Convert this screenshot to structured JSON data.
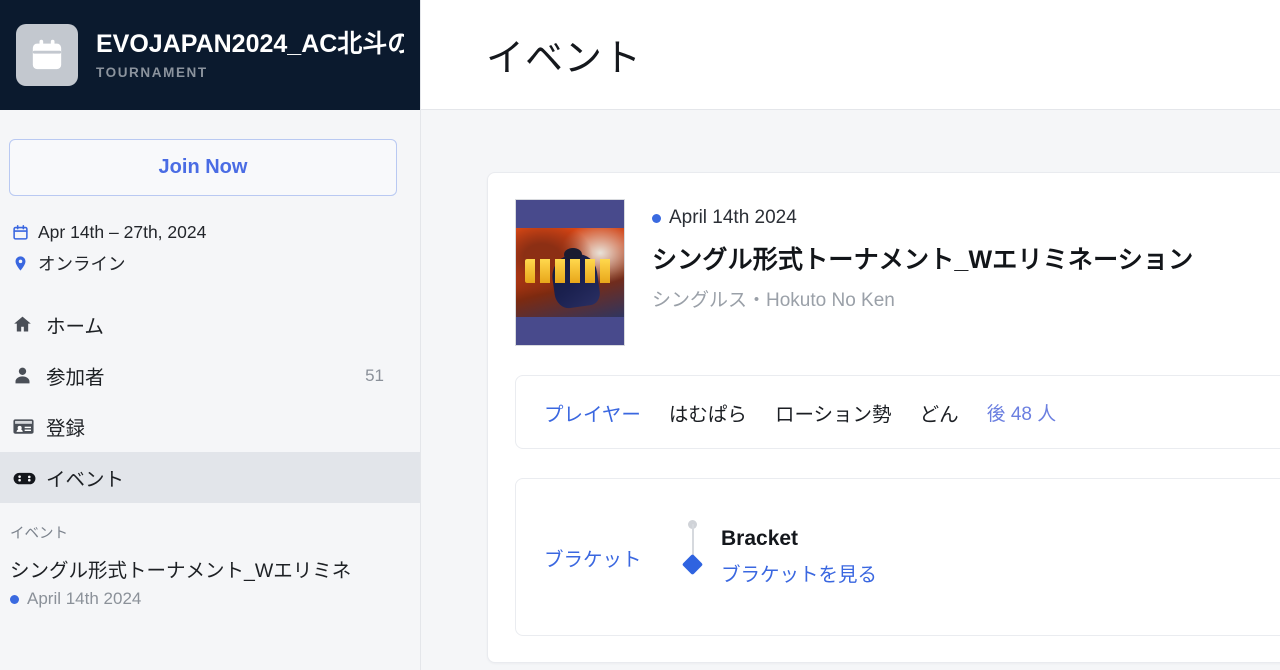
{
  "sidebar": {
    "tournament": {
      "title": "EVOJAPAN2024_AC北斗の",
      "subtitle": "TOURNAMENT",
      "logo_icon": "calendar-icon"
    },
    "join_button": "Join Now",
    "info": [
      {
        "icon": "calendar-icon",
        "text": "Apr 14th – 27th, 2024"
      },
      {
        "icon": "location-pin-icon",
        "text": "オンライン"
      }
    ],
    "nav": [
      {
        "icon": "home-icon",
        "label": "ホーム",
        "count": "",
        "active": false
      },
      {
        "icon": "person-icon",
        "label": "参加者",
        "count": "51",
        "active": false
      },
      {
        "icon": "id-card-icon",
        "label": "登録",
        "count": "",
        "active": false
      },
      {
        "icon": "gamepad-icon",
        "label": "イベント",
        "count": "",
        "active": true
      }
    ],
    "section": {
      "title": "イベント",
      "event_name": "シングル形式トーナメント_Wエリミネ",
      "event_date": "April 14th 2024"
    }
  },
  "header": {
    "page_title": "イベント"
  },
  "event": {
    "date": "April 14th 2024",
    "name": "シングル形式トーナメント_Wエリミネーション",
    "subtitle": "シングルス・Hokuto No Ken",
    "thumbnail_alt": "北斗の拳"
  },
  "players_panel": {
    "label": "プレイヤー",
    "names": [
      "はむぱら",
      "ローション勢",
      "どん"
    ],
    "more": "後 48 人"
  },
  "bracket_panel": {
    "label": "ブラケット",
    "title": "Bracket",
    "link": "ブラケットを見る"
  },
  "colors": {
    "accent_blue": "#3a67e0",
    "header_navy": "#0b1a2e",
    "page_bg": "#f5f6f8",
    "active_nav": "#e2e5ea"
  }
}
